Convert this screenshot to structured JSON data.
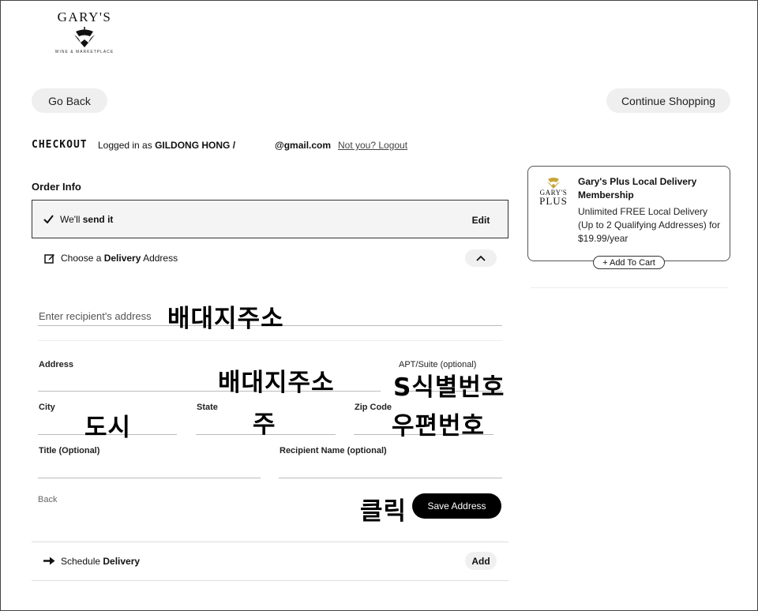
{
  "logo": {
    "word": "GARY'S",
    "tagline": "WINE & MARKETPLACE"
  },
  "nav": {
    "go_back": "Go Back",
    "continue_shopping": "Continue Shopping"
  },
  "checkout": {
    "title": "CHECKOUT",
    "logged_in_prefix": "Logged in as ",
    "user_name": "GILDONG HONG /",
    "email": "@gmail.com",
    "logout": "Not you? Logout"
  },
  "order_info": {
    "heading": "Order Info",
    "send_prefix": "We'll ",
    "send_bold": "send it",
    "edit": "Edit",
    "choose_prefix": "Choose a ",
    "choose_bold": "Delivery",
    "choose_suffix": " Address"
  },
  "form": {
    "recipient_placeholder": "Enter recipient's address",
    "recipient_annotation": "배대지주소",
    "address_label": "Address",
    "address_annotation": "배대지주소",
    "apt_label": "APT/Suite (optional)",
    "apt_annotation": "S식별번호",
    "city_label": "City",
    "city_annotation": "도시",
    "state_label": "State",
    "state_annotation": "주",
    "zip_label": "Zip Code",
    "zip_annotation": "우편번호",
    "title_label": "Title (Optional)",
    "recipient_name_label": "Recipient Name (optional)",
    "back": "Back",
    "click_annotation": "클릭",
    "save": "Save Address"
  },
  "schedule": {
    "prefix": "Schedule ",
    "bold": "Delivery",
    "add": "Add"
  },
  "membership": {
    "logo_top": "GARY'S",
    "logo_bottom": "PLUS",
    "title": "Gary's Plus Local Delivery Membership",
    "description": "Unlimited FREE Local Delivery (Up to 2 Qualifying Addresses) for $19.99/year",
    "add_to_cart": "+ Add To Cart"
  }
}
